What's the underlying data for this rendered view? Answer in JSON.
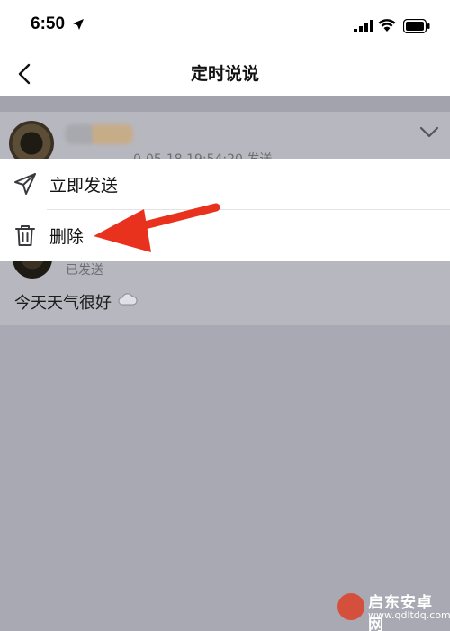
{
  "status_bar": {
    "time": "6:50"
  },
  "nav": {
    "title": "定时说说"
  },
  "post": {
    "scheduled_time": "0-05-18 19:54:20 发送",
    "sent_status": "已发送",
    "text": "今天天气很好"
  },
  "menu": {
    "items": [
      {
        "label": "立即发送",
        "icon": "send-icon"
      },
      {
        "label": "删除",
        "icon": "trash-icon"
      }
    ]
  },
  "watermark": {
    "title": "启东安卓网",
    "url": "www.qdltdq.com"
  },
  "colors": {
    "accent_arrow": "#e8321e",
    "overlay": "#a9a9b3",
    "menu_bg": "#ffffff"
  }
}
